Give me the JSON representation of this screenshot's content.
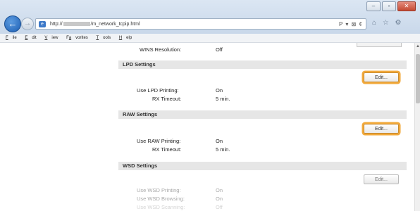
{
  "browser": {
    "address_prefix": "http://",
    "address_suffix": "/m_network_tcpip.html",
    "address_tools": "P ▾ ⊠ ¢",
    "chrome_icons": "⌂ ☆ ⚙"
  },
  "menu": [
    {
      "pre": "",
      "u": "F",
      "post": "ile"
    },
    {
      "pre": "",
      "u": "E",
      "post": "dit"
    },
    {
      "pre": "",
      "u": "V",
      "post": "iew"
    },
    {
      "pre": "F",
      "u": "a",
      "post": "vorites"
    },
    {
      "pre": "",
      "u": "T",
      "post": "ools"
    },
    {
      "pre": "",
      "u": "H",
      "post": "elp"
    }
  ],
  "wins": {
    "label": "WINS Resolution:",
    "value": "Off"
  },
  "lpd": {
    "title": "LPD Settings",
    "edit_label": "Edit...",
    "use_label": "Use LPD Printing:",
    "use_value": "On",
    "timeout_label": "RX Timeout:",
    "timeout_value": "5 min."
  },
  "raw": {
    "title": "RAW Settings",
    "edit_label": "Edit...",
    "use_label": "Use RAW Printing:",
    "use_value": "On",
    "timeout_label": "RX Timeout:",
    "timeout_value": "5 min."
  },
  "wsd": {
    "title": "WSD Settings",
    "edit_label": "Edit...",
    "printing_label": "Use WSD Printing:",
    "printing_value": "On",
    "browsing_label": "Use WSD Browsing:",
    "browsing_value": "On",
    "scanning_label": "Use WSD Scanning:",
    "scanning_value": "Off"
  },
  "colors": {
    "highlight": "#f2a93b",
    "section_bg": "#e6e6e6",
    "page_bg": "#ffffff"
  }
}
